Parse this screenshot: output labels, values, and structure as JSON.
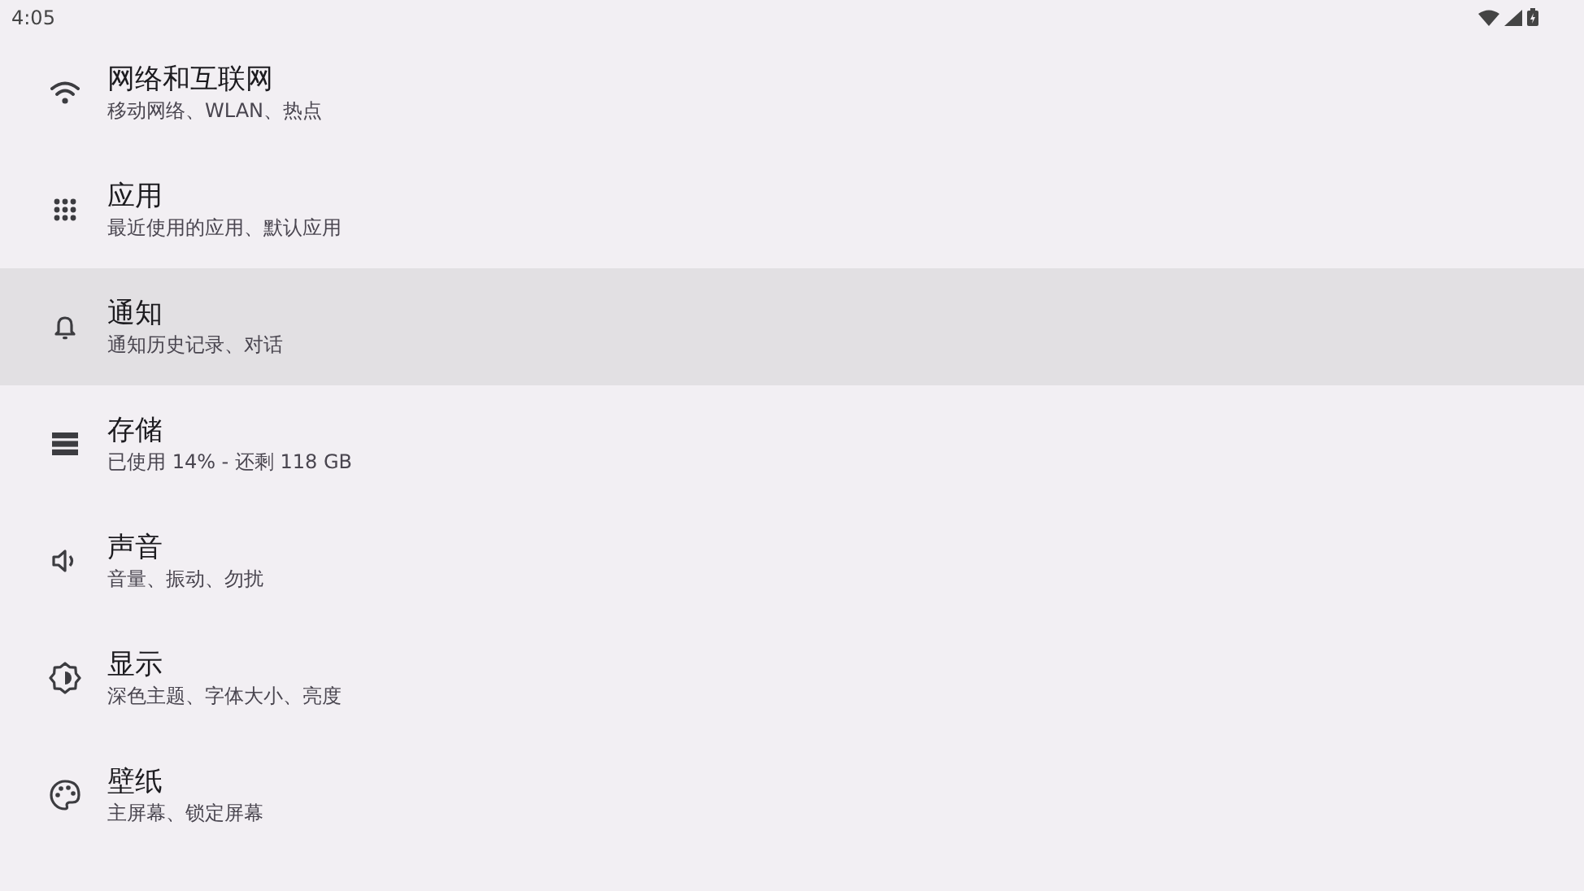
{
  "status_bar": {
    "time": "4:05"
  },
  "settings": [
    {
      "title": "网络和互联网",
      "summary": "移动网络、WLAN、热点",
      "kind": "wifi",
      "selected": false
    },
    {
      "title": "应用",
      "summary": "最近使用的应用、默认应用",
      "kind": "apps",
      "selected": false
    },
    {
      "title": "通知",
      "summary": "通知历史记录、对话",
      "kind": "bell",
      "selected": true
    },
    {
      "title": "存储",
      "summary": "已使用 14% - 还剩 118 GB",
      "kind": "storage",
      "selected": false
    },
    {
      "title": "声音",
      "summary": "音量、振动、勿扰",
      "kind": "sound",
      "selected": false
    },
    {
      "title": "显示",
      "summary": "深色主题、字体大小、亮度",
      "kind": "display",
      "selected": false
    },
    {
      "title": "壁纸",
      "summary": "主屏幕、锁定屏幕",
      "kind": "palette",
      "selected": false
    }
  ]
}
